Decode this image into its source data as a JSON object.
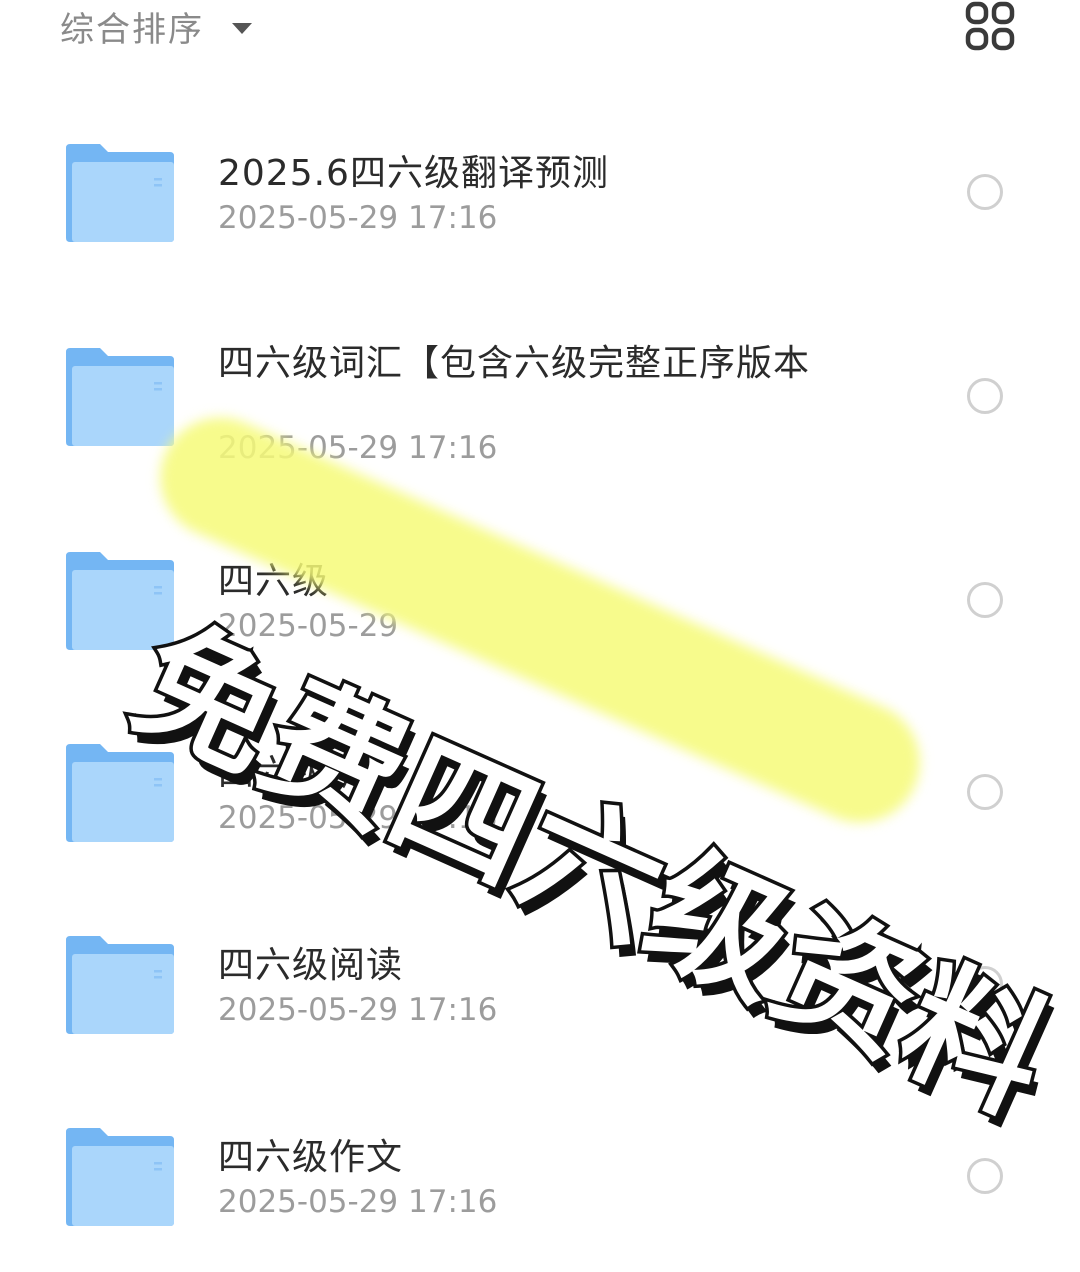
{
  "header": {
    "sort_label": "综合排序",
    "caret_icon": "caret-down-icon",
    "view_toggle_icon": "grid-view-icon"
  },
  "folders": [
    {
      "name": "2025.6四六级翻译预测",
      "date": "2025-05-29 17:16"
    },
    {
      "name": "四六级词汇【包含六级完整正序版本",
      "date": "2025-05-29 17:16"
    },
    {
      "name": "四六级",
      "date": "2025-05-29"
    },
    {
      "name": "四六级听力",
      "date": "2025-05-29 17:16"
    },
    {
      "name": "四六级阅读",
      "date": "2025-05-29 17:16"
    },
    {
      "name": "四六级作文",
      "date": "2025-05-29 17:16"
    }
  ],
  "promo": {
    "text": "免费四六级资料",
    "highlight_color": "#f6fa78"
  },
  "colors": {
    "folder_light": "#aad6fb",
    "folder_dark": "#74b6f3",
    "text_primary": "#2b2b2b",
    "text_secondary": "#9c9c9c"
  }
}
